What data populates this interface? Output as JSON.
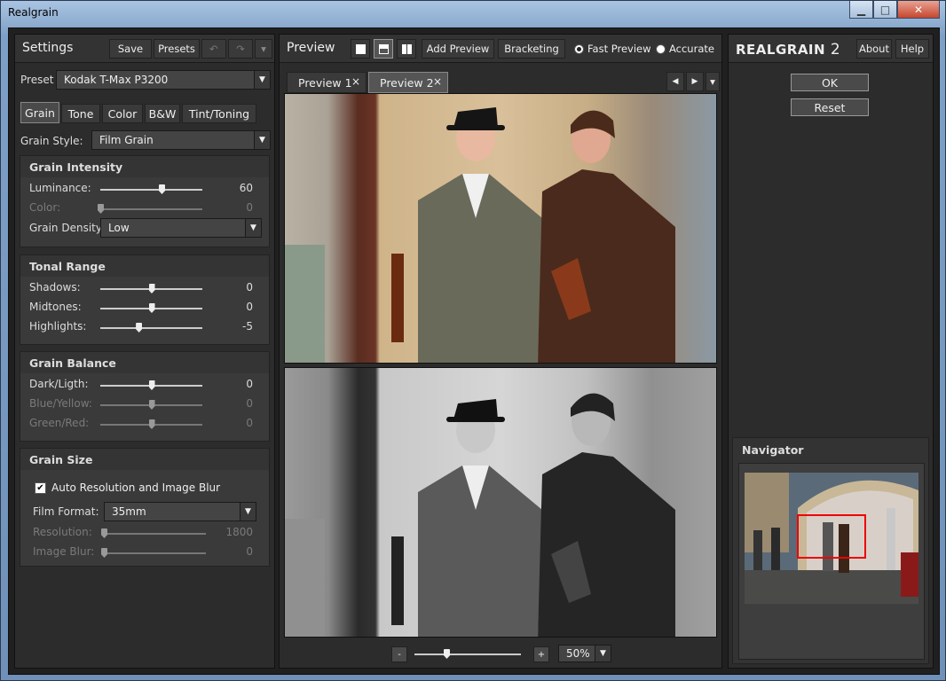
{
  "window": {
    "title": "Realgrain",
    "min": "▁",
    "max": "□",
    "close": "✕"
  },
  "settings": {
    "title": "Settings",
    "save": "Save",
    "presets": "Presets",
    "undo": "↶",
    "redo": "↷",
    "menu": "▾",
    "preset_label": "Preset",
    "preset_value": "Kodak T-Max P3200",
    "tabs": [
      "Grain",
      "Tone",
      "Color",
      "B&W",
      "Tint/Toning"
    ],
    "grain_style_label": "Grain Style:",
    "grain_style_value": "Film Grain",
    "intensity": {
      "title": "Grain Intensity",
      "luminance": {
        "label": "Luminance:",
        "value": "60",
        "pos": 0.6
      },
      "color": {
        "label": "Color:",
        "value": "0",
        "pos": 0
      },
      "density_label": "Grain Density",
      "density_value": "Low"
    },
    "tonal": {
      "title": "Tonal Range",
      "shadows": {
        "label": "Shadows:",
        "value": "0",
        "pos": 0.5
      },
      "midtones": {
        "label": "Midtones:",
        "value": "0",
        "pos": 0.5
      },
      "highlights": {
        "label": "Highlights:",
        "value": "-5",
        "pos": 0.375
      }
    },
    "balance": {
      "title": "Grain Balance",
      "dark": {
        "label": "Dark/Ligth:",
        "value": "0",
        "pos": 0.5
      },
      "blue": {
        "label": "Blue/Yellow:",
        "value": "0",
        "pos": 0.5
      },
      "green": {
        "label": "Green/Red:",
        "value": "0",
        "pos": 0.5
      }
    },
    "size": {
      "title": "Grain Size",
      "auto_label": "Auto Resolution and Image Blur",
      "auto_checked": true,
      "check": "✔",
      "film_label": "Film Format:",
      "film_value": "35mm",
      "resolution": {
        "label": "Resolution:",
        "value": "1800",
        "pos": 0
      },
      "blur": {
        "label": "Image Blur:",
        "value": "0",
        "pos": 0
      }
    }
  },
  "preview": {
    "title": "Preview",
    "add": "Add Preview",
    "bracketing": "Bracketing",
    "fast": "Fast Preview",
    "accurate": "Accurate",
    "tabs": [
      {
        "label": "Preview 1",
        "close": "×"
      },
      {
        "label": "Preview 2",
        "close": "×"
      }
    ],
    "nav_left": "◀",
    "nav_right": "▶",
    "nav_menu": "▾",
    "zoom_minus": "-",
    "zoom_plus": "+",
    "zoom_value": "50%",
    "zoom_pos": 0.3
  },
  "right": {
    "brand": "REALGRAIN",
    "version": "2",
    "about": "About",
    "help": "Help",
    "ok": "OK",
    "reset": "Reset",
    "navigator": "Navigator"
  }
}
